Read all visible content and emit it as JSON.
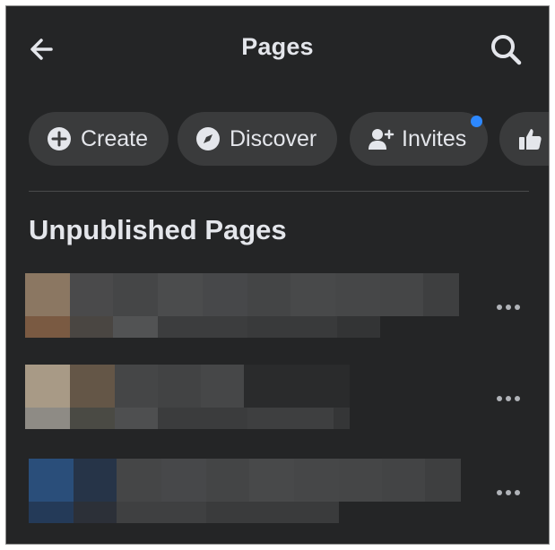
{
  "header": {
    "title": "Pages",
    "back_icon": "arrow-left-icon",
    "search_icon": "search-icon"
  },
  "chips": [
    {
      "label": "Create",
      "icon": "plus-circle-icon"
    },
    {
      "label": "Discover",
      "icon": "compass-icon"
    },
    {
      "label": "Invites",
      "icon": "person-add-icon",
      "has_notification": true
    },
    {
      "label": "",
      "icon": "thumbs-up-icon"
    }
  ],
  "section": {
    "title": "Unpublished Pages"
  },
  "pages": [
    {
      "more_icon": "more-horizontal-icon",
      "thumbnail_color": "#8b7762"
    },
    {
      "more_icon": "more-horizontal-icon",
      "thumbnail_color": "#a89a86"
    },
    {
      "more_icon": "more-horizontal-icon",
      "thumbnail_color": "#2a4e7a"
    }
  ],
  "colors": {
    "background": "#242526",
    "chip": "#3a3b3c",
    "text": "#e4e6eb",
    "notification": "#2d88ff"
  }
}
